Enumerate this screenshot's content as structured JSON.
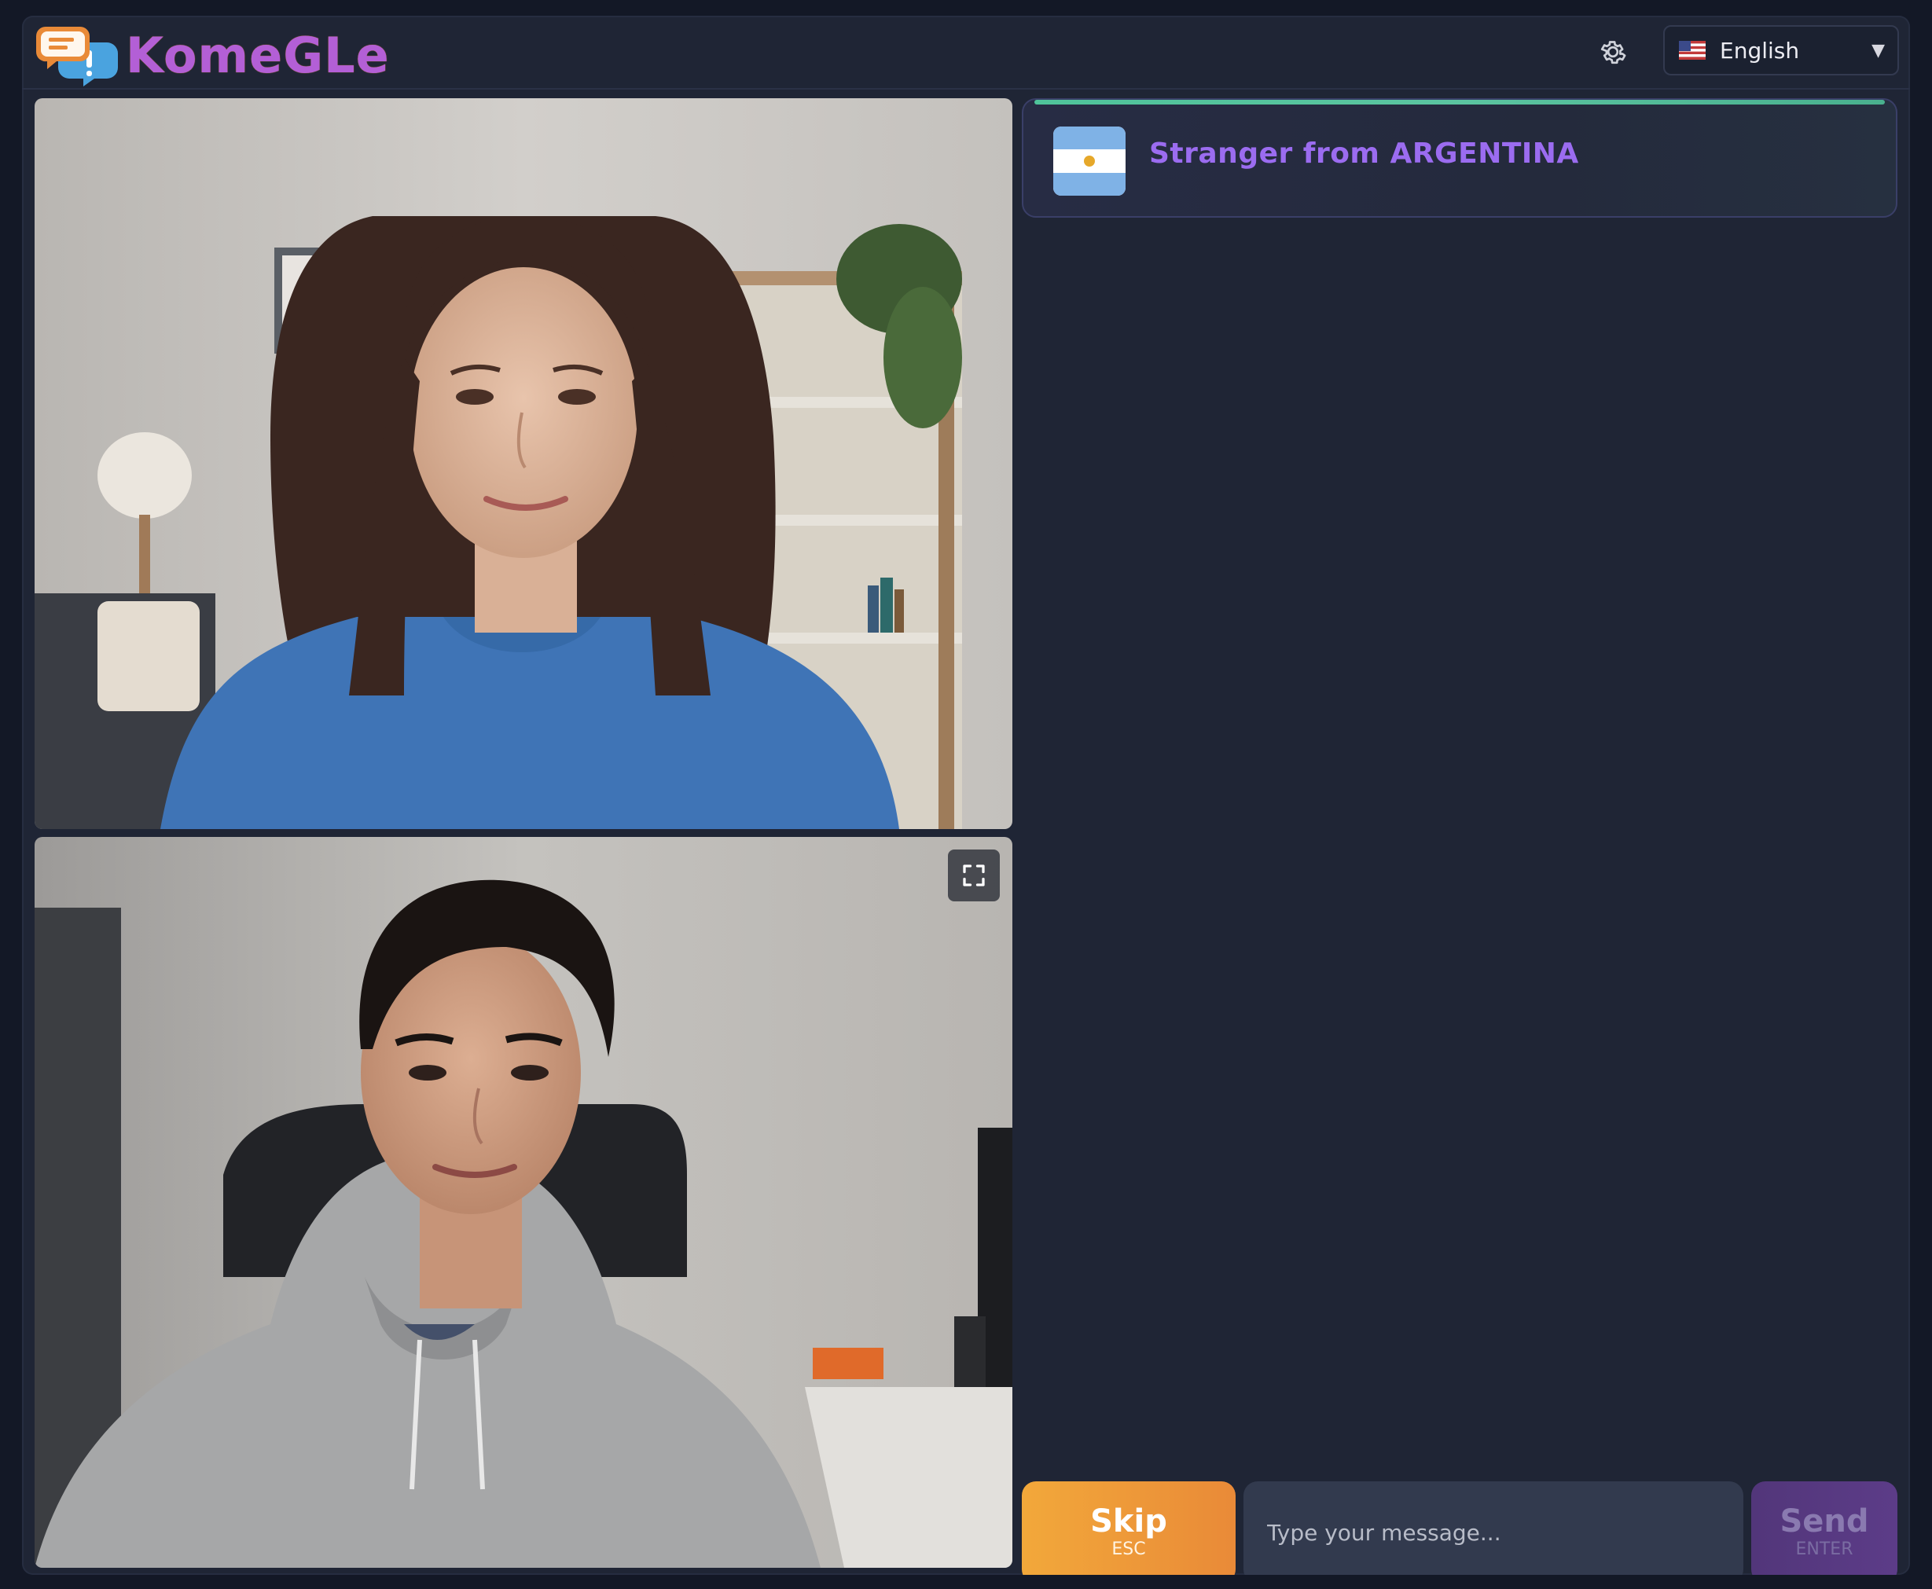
{
  "app": {
    "brand": "KomeGLe",
    "accent_color": "#9b6cf0",
    "brand_colors": [
      "#e98a38",
      "#4aa3df",
      "#b35fd6"
    ]
  },
  "header": {
    "settings_icon": "gear-icon",
    "language": {
      "selected": "English",
      "flag_icon": "us-flag-icon"
    }
  },
  "stranger": {
    "label": "Stranger from ARGENTINA",
    "flag_icon": "argentina-flag-icon",
    "status_color": "#4fc39a"
  },
  "videos": {
    "stranger_feed": "video-feed",
    "self_feed": "video-feed",
    "fullscreen_icon": "fullscreen-icon"
  },
  "controls": {
    "skip_label": "Skip",
    "skip_hint": "ESC",
    "skip_color": "#f2a83a",
    "input_placeholder": "Type your message...",
    "send_label": "Send",
    "send_hint": "ENTER"
  }
}
